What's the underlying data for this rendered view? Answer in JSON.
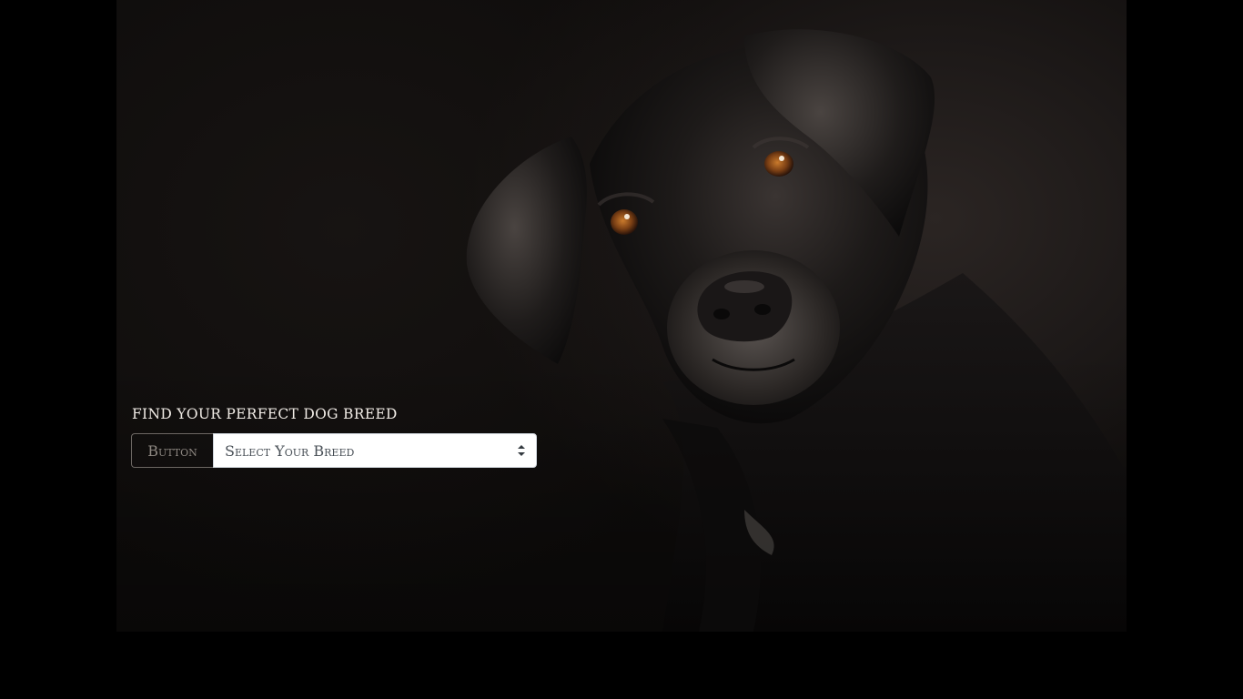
{
  "hero": {
    "image_subject": "black labrador dog portrait"
  },
  "search": {
    "title": "FIND YOUR PERFECT DOG BREED",
    "button_label": "Button",
    "select_value": "Select Your Breed"
  },
  "icons": {
    "select_caret": "chevron-updown-icon"
  },
  "colors": {
    "page_background": "#000000",
    "title_text": "#f1ece6",
    "button_border": "#6c6763",
    "select_background": "#ffffff"
  }
}
